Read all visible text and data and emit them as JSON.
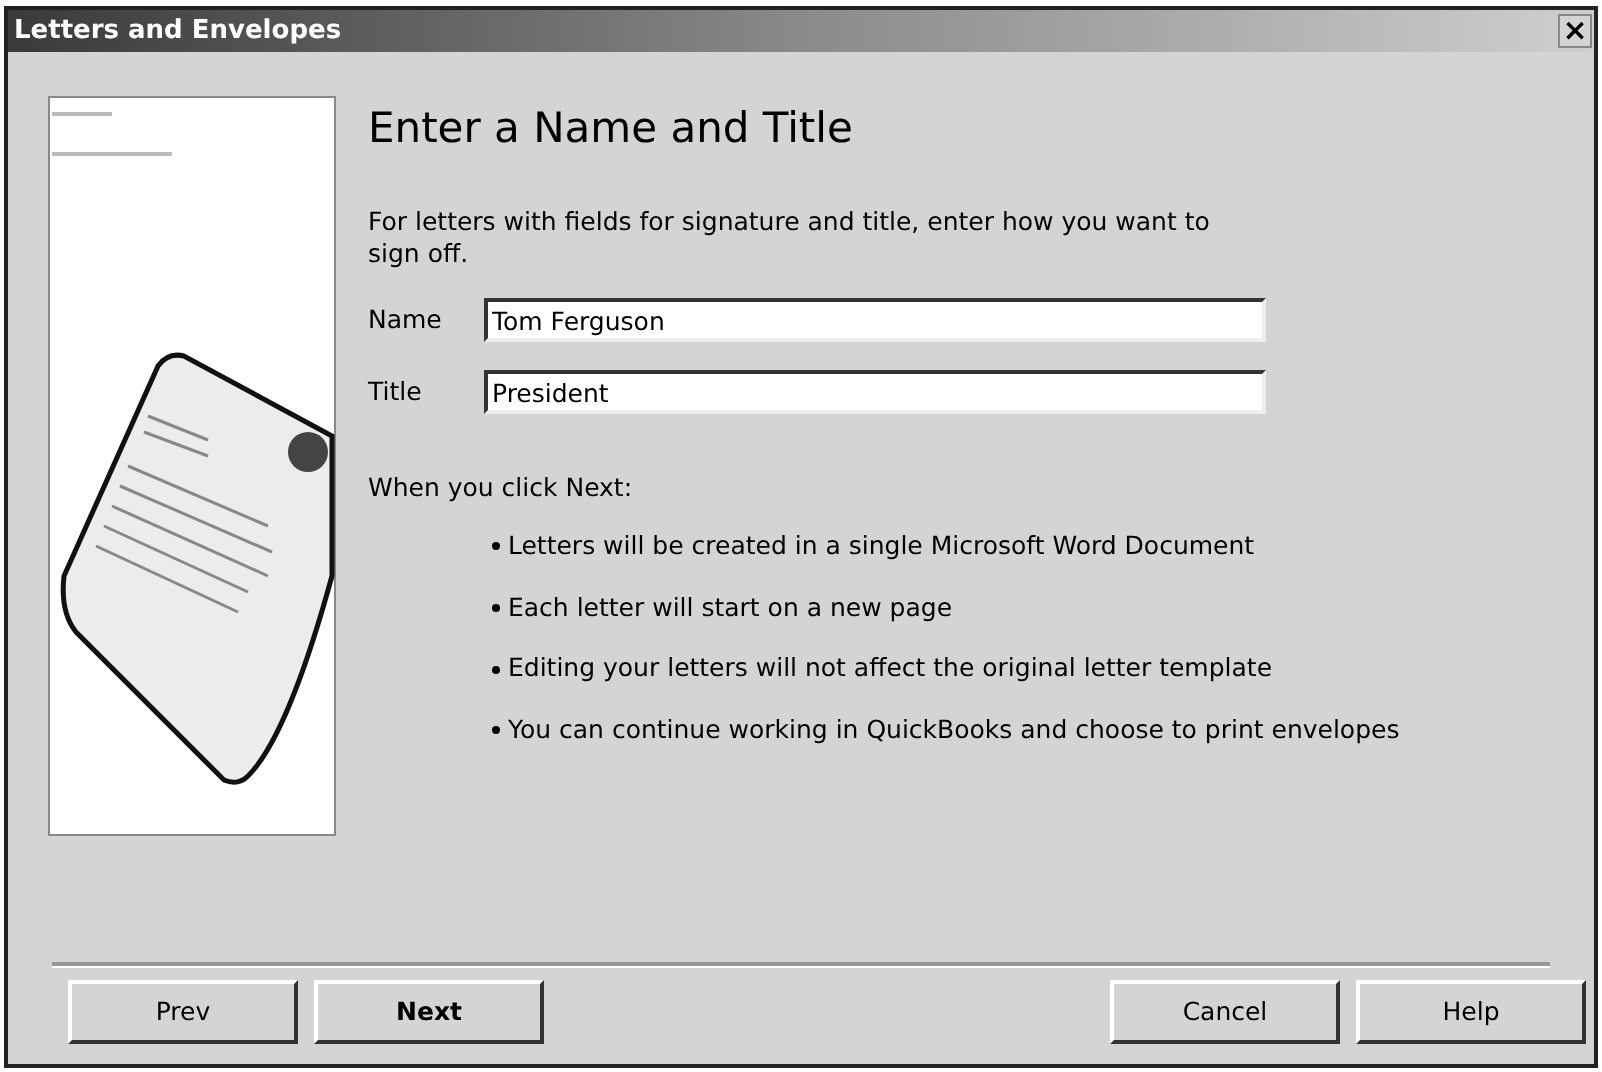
{
  "window": {
    "title": "Letters and Envelopes",
    "close": "×"
  },
  "heading": "Enter a Name and Title",
  "intro": "For letters with fields for signature and title, enter how you want to sign off.",
  "fields": [
    {
      "label": "Name",
      "value": "Tom Ferguson"
    },
    {
      "label": "Title",
      "value": "President"
    }
  ],
  "notes_heading": "When you click Next:",
  "notes": [
    "Letters will be created in a single Microsoft Word Document",
    "Each letter will start on a new page",
    "Editing your letters will not affect the original letter template",
    "You can continue working in QuickBooks and choose to print envelopes"
  ],
  "buttons_left": [
    {
      "label": "Prev",
      "bold": false
    },
    {
      "label": "Next",
      "bold": true
    }
  ],
  "buttons_right": [
    {
      "label": "Cancel",
      "bold": false
    },
    {
      "label": "Help",
      "bold": false
    }
  ]
}
